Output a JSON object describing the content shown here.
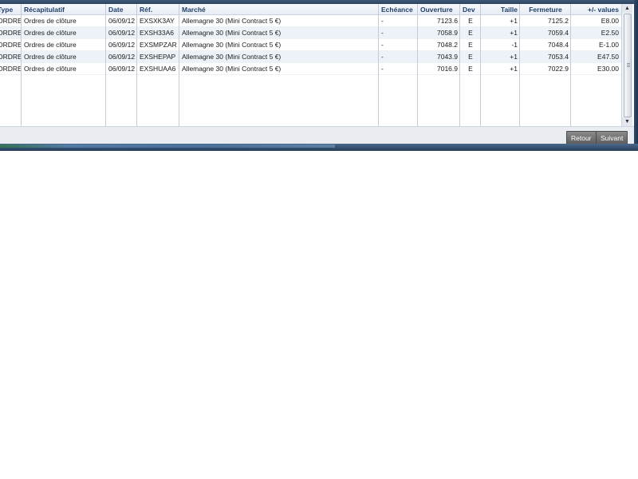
{
  "table": {
    "columns": [
      "Type",
      "Récapitulatif",
      "Date",
      "Réf.",
      "Marché",
      "Echéance",
      "Ouverture",
      "Dev",
      "Taille",
      "Fermeture",
      "+/- values"
    ],
    "rows": [
      [
        "ORDRE",
        "Ordres de clôture",
        "06/09/12",
        "EXSXK3AY",
        "Allemagne 30 (Mini Contract 5 €)",
        "-",
        "7123.6",
        "E",
        "+1",
        "7125.2",
        "E8.00"
      ],
      [
        "ORDRE",
        "Ordres de clôture",
        "06/09/12",
        "EXSH33A6",
        "Allemagne 30 (Mini Contract 5 €)",
        "-",
        "7058.9",
        "E",
        "+1",
        "7059.4",
        "E2.50"
      ],
      [
        "ORDRE",
        "Ordres de clôture",
        "06/09/12",
        "EXSMPZAR",
        "Allemagne 30 (Mini Contract 5 €)",
        "-",
        "7048.2",
        "E",
        "-1",
        "7048.4",
        "E-1.00"
      ],
      [
        "ORDRE",
        "Ordres de clôture",
        "06/09/12",
        "EXSHEPAP",
        "Allemagne 30 (Mini Contract 5 €)",
        "-",
        "7043.9",
        "E",
        "+1",
        "7053.4",
        "E47.50"
      ],
      [
        "ORDRE",
        "Ordres de clôture",
        "06/09/12",
        "EXSHUAA6",
        "Allemagne 30 (Mini Contract 5 €)",
        "-",
        "7016.9",
        "E",
        "+1",
        "7022.9",
        "E30.00"
      ]
    ]
  },
  "footer": {
    "back_label": "Retour",
    "next_label": "Suivant"
  },
  "icons": {
    "scroll_up": "▲",
    "scroll_down": "▼"
  },
  "colors": {
    "header_text": "#1f3f6a",
    "frame": "#2b4462",
    "button": "#6e6e6e"
  }
}
